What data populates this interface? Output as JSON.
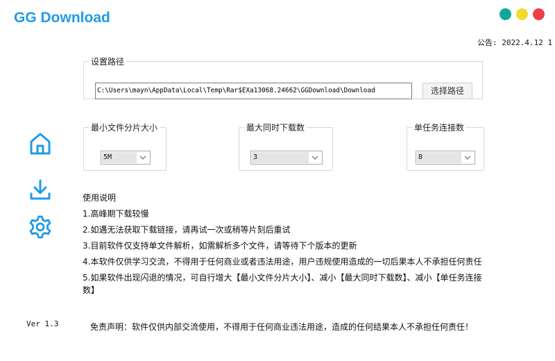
{
  "app": {
    "title": "GG Download"
  },
  "window_controls": [
    {
      "name": "teal",
      "color": "#0fa89a"
    },
    {
      "name": "yellow",
      "color": "#f3db2e"
    },
    {
      "name": "red",
      "color": "#ee3f45"
    }
  ],
  "notice": "公告: 2022.4.12 1",
  "sidebar": {
    "accent": "#1e9be8",
    "items": [
      {
        "icon": "home-icon"
      },
      {
        "icon": "download-icon"
      },
      {
        "icon": "settings-icon"
      }
    ]
  },
  "path_group": {
    "legend": "设置路径",
    "path": "C:\\Users\\mayn\\AppData\\Local\\Temp\\Rar$EXa13068.24662\\GGDownload\\Download",
    "button_label": "选择路径"
  },
  "settings": [
    {
      "legend": "最小文件分片大小",
      "value": "5M"
    },
    {
      "legend": "最大同时下载数",
      "value": "3"
    },
    {
      "legend": "单任务连接数",
      "value": "8"
    }
  ],
  "instructions": {
    "title": "使用说明",
    "items": [
      "1.高峰期下载较慢",
      "2.如遇无法获取下载链接，请再试一次或稍等片刻后重试",
      "3.目前软件仅支持单文件解析，如需解析多个文件，请等待下个版本的更新",
      "4.本软件仅供学习交流，不得用于任何商业或者违法用途，用户违规使用造成的一切后果本人不承担任何责任",
      "5.如果软件出现闪退的情况，可自行增大【最小文件分片大小】、减小【最大同时下载数】、减小【单任务连接数】"
    ]
  },
  "version": "Ver 1.3",
  "disclaimer": "免责声明：软件仅供内部交流使用，不得用于任何商业违法用途，造成的任何结果本人不承担任何责任！"
}
